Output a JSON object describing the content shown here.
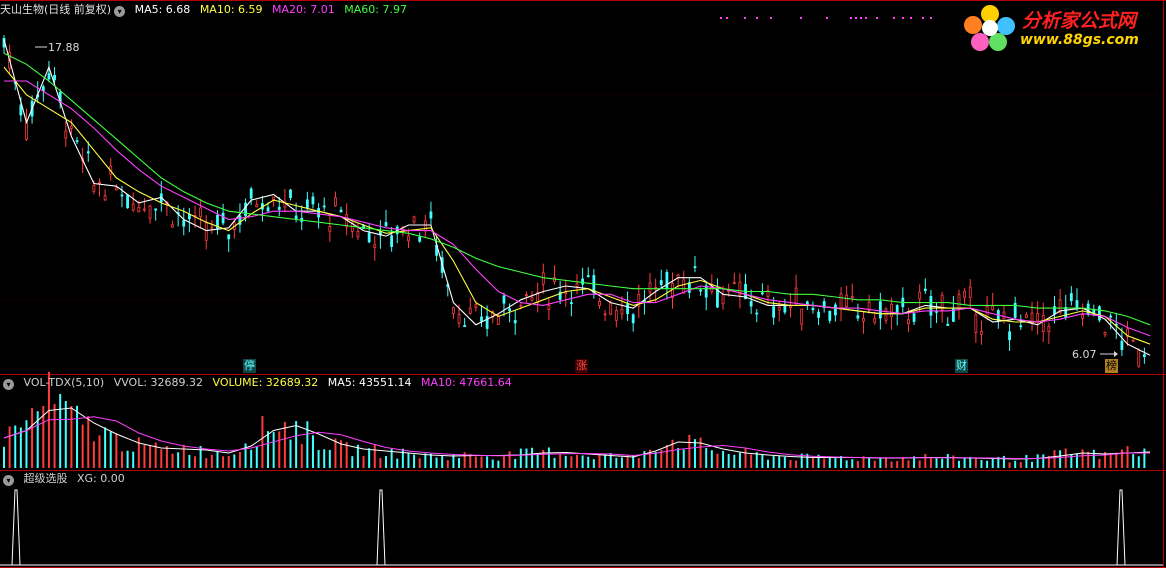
{
  "price_panel": {
    "stock_name": "天山生物(日线 前复权)",
    "ma5": "MA5: 6.68",
    "ma10": "MA10: 6.59",
    "ma20": "MA20: 7.01",
    "ma60": "MA60: 7.97",
    "high_label": "17.88",
    "low_label": "6.07",
    "markers": [
      "停",
      "涨",
      "财",
      "榜"
    ]
  },
  "volume_panel": {
    "indicator": "VOL-TDX(5,10)",
    "vvol": "VVOL: 32689.32",
    "volume": "VOLUME: 32689.32",
    "ma5": "MA5: 43551.14",
    "ma10": "MA10: 47661.64"
  },
  "signal_panel": {
    "name": "超级选股",
    "xg": "XG: 0.00"
  },
  "logo": {
    "text": "分析家公式网",
    "url": "www.88gs.com"
  },
  "colors": {
    "up": "#ff3c3c",
    "down": "#40ffff",
    "ma5": "#ffffff",
    "ma10": "#ffff40",
    "ma20": "#ff40ff",
    "ma60": "#40ff40",
    "axis": "#b00000"
  },
  "chart_data": [
    {
      "type": "line",
      "title": "天山生物(日线 前复权)",
      "y_range": [
        6.07,
        17.88
      ],
      "series": [
        {
          "name": "MA5",
          "values": [
            17.5,
            14.5,
            16.5,
            14.0,
            12.3,
            12.2,
            11.6,
            11.8,
            11.0,
            10.6,
            10.7,
            11.7,
            11.9,
            11.3,
            11.3,
            11.1,
            10.6,
            10.4,
            10.8,
            10.8,
            8.0,
            7.2,
            7.6,
            8.1,
            8.4,
            8.6,
            8.5,
            8.0,
            7.8,
            8.4,
            8.9,
            8.9,
            8.3,
            8.2,
            7.9,
            7.9,
            7.9,
            7.8,
            7.7,
            7.6,
            7.6,
            7.9,
            7.8,
            7.8,
            7.3,
            7.4,
            7.2,
            7.7,
            7.8,
            7.4,
            6.5,
            6.1
          ]
        },
        {
          "name": "MA10",
          "values": [
            16.5,
            15.5,
            15.0,
            14.5,
            13.5,
            12.5,
            12.0,
            11.6,
            11.3,
            10.9,
            10.6,
            11.2,
            11.7,
            11.5,
            11.3,
            11.1,
            10.8,
            10.5,
            10.6,
            10.7,
            9.5,
            8.0,
            7.5,
            7.8,
            8.1,
            8.4,
            8.5,
            8.2,
            7.9,
            8.1,
            8.6,
            8.8,
            8.5,
            8.3,
            8.0,
            7.9,
            7.9,
            7.8,
            7.7,
            7.6,
            7.6,
            7.8,
            7.8,
            7.8,
            7.4,
            7.3,
            7.3,
            7.5,
            7.7,
            7.5,
            6.8,
            6.5
          ]
        },
        {
          "name": "MA20",
          "values": [
            16.0,
            16.0,
            15.5,
            15.0,
            14.3,
            13.5,
            12.8,
            12.2,
            11.8,
            11.4,
            11.0,
            11.1,
            11.3,
            11.3,
            11.2,
            11.1,
            10.9,
            10.7,
            10.6,
            10.6,
            10.1,
            9.2,
            8.4,
            8.0,
            7.9,
            8.1,
            8.3,
            8.3,
            8.0,
            8.0,
            8.3,
            8.6,
            8.5,
            8.3,
            8.1,
            8.0,
            7.9,
            7.8,
            7.8,
            7.7,
            7.6,
            7.7,
            7.7,
            7.8,
            7.6,
            7.4,
            7.3,
            7.4,
            7.6,
            7.5,
            7.1,
            6.8
          ]
        },
        {
          "name": "MA60",
          "values": [
            17.0,
            16.6,
            16.0,
            15.3,
            14.6,
            13.9,
            13.2,
            12.5,
            12.0,
            11.6,
            11.3,
            11.2,
            11.1,
            11.0,
            10.9,
            10.8,
            10.7,
            10.6,
            10.5,
            10.3,
            10.0,
            9.6,
            9.3,
            9.1,
            8.9,
            8.8,
            8.7,
            8.6,
            8.5,
            8.5,
            8.5,
            8.5,
            8.5,
            8.4,
            8.4,
            8.3,
            8.3,
            8.2,
            8.1,
            8.1,
            8.0,
            8.0,
            8.0,
            7.9,
            7.9,
            7.9,
            7.8,
            7.8,
            7.8,
            7.7,
            7.5,
            7.2
          ]
        }
      ]
    },
    {
      "type": "bar",
      "title": "VOL-TDX(5,10)",
      "values": [
        30,
        45,
        70,
        50,
        40,
        28,
        22,
        18,
        20,
        16,
        14,
        30,
        45,
        40,
        28,
        20,
        18,
        16,
        14,
        12,
        12,
        13,
        12,
        14,
        16,
        15,
        13,
        12,
        10,
        24,
        28,
        22,
        16,
        14,
        12,
        11,
        10,
        11,
        10,
        10,
        10,
        11,
        10,
        10,
        9,
        9,
        10,
        14,
        16,
        12,
        18,
        14
      ]
    },
    {
      "type": "line",
      "title": "超级选股",
      "series": [
        {
          "name": "XG",
          "values": [
            1,
            0,
            0,
            0,
            0,
            0,
            0,
            0,
            0,
            0,
            0,
            0,
            0,
            0,
            0,
            0,
            0,
            0,
            0,
            0,
            0,
            1,
            0,
            0,
            0,
            0,
            0,
            0,
            0,
            0,
            0,
            0,
            0,
            0,
            0,
            0,
            0,
            0,
            0,
            0,
            0,
            0,
            0,
            0,
            0,
            0,
            0,
            0,
            0,
            0,
            0,
            1
          ]
        }
      ]
    }
  ]
}
